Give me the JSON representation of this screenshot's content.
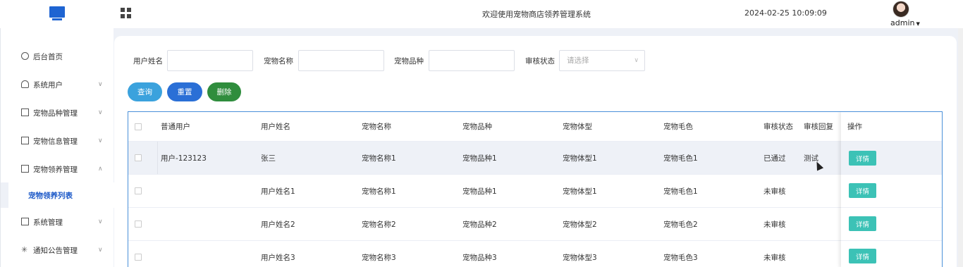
{
  "header": {
    "welcome": "欢迎使用宠物商店领养管理系统",
    "datetime": "2024-02-25 10:09:09",
    "user": "admin"
  },
  "sidebar": {
    "items": [
      {
        "label": "后台首页",
        "icon": "clock-icon"
      },
      {
        "label": "系统用户",
        "icon": "person-icon"
      },
      {
        "label": "宠物品种管理",
        "icon": "card-icon"
      },
      {
        "label": "宠物信息管理",
        "icon": "card-icon"
      },
      {
        "label": "宠物领养管理",
        "icon": "card-icon"
      },
      {
        "label": "系统管理",
        "icon": "folder-icon"
      },
      {
        "label": "通知公告管理",
        "icon": "loading-icon"
      }
    ],
    "active_sub": "宠物领养列表"
  },
  "filters": {
    "user_name_label": "用户姓名",
    "pet_name_label": "宠物名称",
    "pet_breed_label": "宠物品种",
    "status_label": "审核状态",
    "status_placeholder": "请选择"
  },
  "buttons": {
    "query": "查询",
    "reset": "重置",
    "delete": "删除"
  },
  "table": {
    "columns": [
      "普通用户",
      "用户姓名",
      "宠物名称",
      "宠物品种",
      "宠物体型",
      "宠物毛色",
      "审核状态",
      "审核回复",
      "操作"
    ],
    "rows": [
      {
        "user": "用户-123123",
        "name": "张三",
        "pet": "宠物名称1",
        "breed": "宠物品种1",
        "size": "宠物体型1",
        "color": "宠物毛色1",
        "status": "已通过",
        "reply": "测试",
        "action": "详情"
      },
      {
        "user": "",
        "name": "用户姓名1",
        "pet": "宠物名称1",
        "breed": "宠物品种1",
        "size": "宠物体型1",
        "color": "宠物毛色1",
        "status": "未审核",
        "reply": "",
        "action": "详情"
      },
      {
        "user": "",
        "name": "用户姓名2",
        "pet": "宠物名称2",
        "breed": "宠物品种2",
        "size": "宠物体型2",
        "color": "宠物毛色2",
        "status": "未审核",
        "reply": "",
        "action": "详情"
      },
      {
        "user": "",
        "name": "用户姓名3",
        "pet": "宠物名称3",
        "breed": "宠物品种3",
        "size": "宠物体型3",
        "color": "宠物毛色3",
        "status": "未审核",
        "reply": "",
        "action": "详情"
      }
    ]
  },
  "colors": {
    "primary": "#2a6fd6",
    "query": "#3ba2dd",
    "delete": "#2f8d3d",
    "detail": "#3cc2b6"
  }
}
